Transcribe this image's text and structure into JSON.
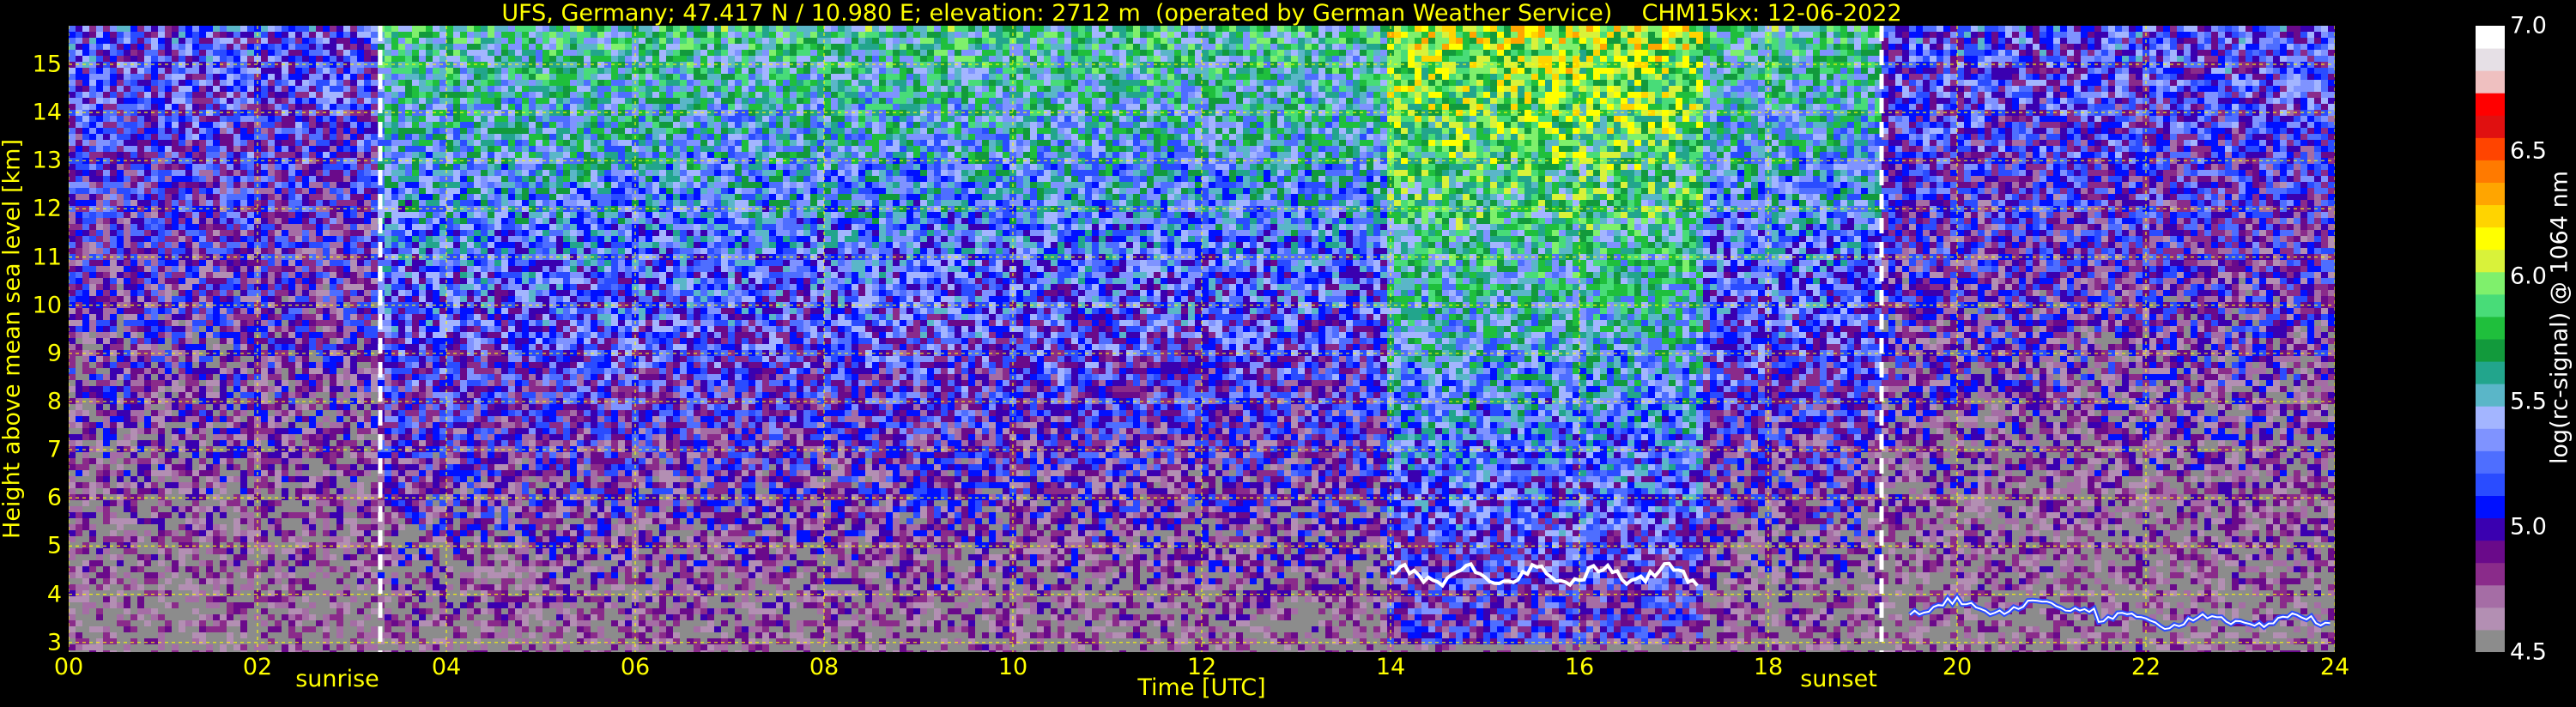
{
  "header": {
    "title": "UFS, Germany; 47.417 N / 10.980 E; elevation: 2712 m  (operated by German Weather Service)    CHM15kx: 12-06-2022"
  },
  "chart_data": {
    "type": "heatmap",
    "title": "UFS, Germany; 47.417 N / 10.980 E; elevation: 2712 m  (operated by German Weather Service)    CHM15kx: 12-06-2022",
    "xlabel": "Time [UTC]",
    "ylabel": "Height above mean sea level [km]",
    "colorbar_label": "log(rc-signal) @ 1064 nm",
    "xlim": [
      0,
      24
    ],
    "ylim": [
      2.8,
      15.8
    ],
    "clim": [
      4.5,
      7.0
    ],
    "x_ticks": [
      "00",
      "02",
      "04",
      "06",
      "08",
      "10",
      "12",
      "14",
      "16",
      "18",
      "20",
      "22",
      "24"
    ],
    "x_tick_values": [
      0,
      2,
      4,
      6,
      8,
      10,
      12,
      14,
      16,
      18,
      20,
      22,
      24
    ],
    "y_ticks": [
      "3",
      "4",
      "5",
      "6",
      "7",
      "8",
      "9",
      "10",
      "11",
      "12",
      "13",
      "14",
      "15"
    ],
    "y_tick_values": [
      3,
      4,
      5,
      6,
      7,
      8,
      9,
      10,
      11,
      12,
      13,
      14,
      15
    ],
    "colorbar_ticks": [
      "4.5",
      "5.0",
      "5.5",
      "6.0",
      "6.5",
      "7.0"
    ],
    "colorbar_tick_values": [
      4.5,
      5.0,
      5.5,
      6.0,
      6.5,
      7.0
    ],
    "grid": true,
    "events": [
      {
        "label": "sunrise",
        "time_utc": 3.3
      },
      {
        "label": "sunset",
        "time_utc": 19.2
      }
    ],
    "colormap": [
      "#8c8c8c",
      "#b38fb3",
      "#a56da5",
      "#8a2b8a",
      "#6a0a8a",
      "#3a00b0",
      "#0010ff",
      "#2a4cff",
      "#4e6eff",
      "#7f93ff",
      "#a3b5ff",
      "#5ab6c8",
      "#22a58c",
      "#129a3c",
      "#1fbf3c",
      "#48dc78",
      "#7ff06c",
      "#d9f23a",
      "#ffff00",
      "#ffd400",
      "#ffa500",
      "#ff7a00",
      "#ff4400",
      "#e01010",
      "#ff0000",
      "#efc0c0",
      "#e6e0e6",
      "#ffffff"
    ]
  }
}
